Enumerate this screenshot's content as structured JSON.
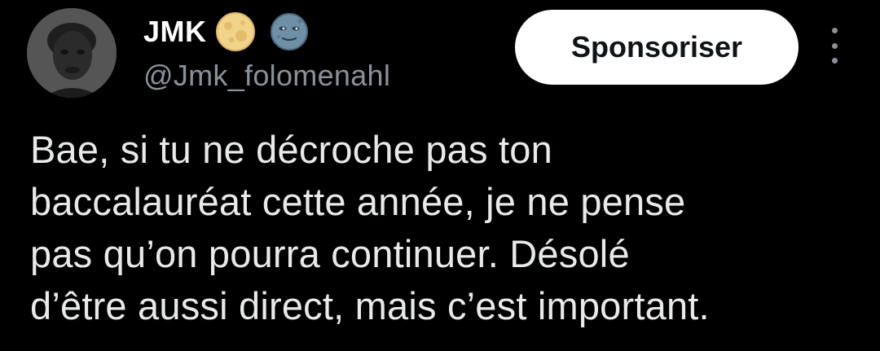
{
  "author": {
    "display_name": "JMK",
    "handle": "@Jmk_folomenahl",
    "badges": [
      "full-moon-emoji",
      "new-moon-face-emoji"
    ]
  },
  "actions": {
    "sponsor_label": "Sponsoriser",
    "more_icon": "more-vertical-icon"
  },
  "tweet": {
    "lines": [
      "Bae, si tu ne décroche pas ton",
      "baccalauréat cette année, je ne pense",
      "pas qu’on pourra continuer. Désolé",
      "d’être aussi direct, mais c’est important."
    ]
  },
  "colors": {
    "background": "#000000",
    "text": "#e7e9ea",
    "secondary_text": "#8b9198",
    "button_bg": "#ffffff",
    "button_text": "#0f1419"
  }
}
